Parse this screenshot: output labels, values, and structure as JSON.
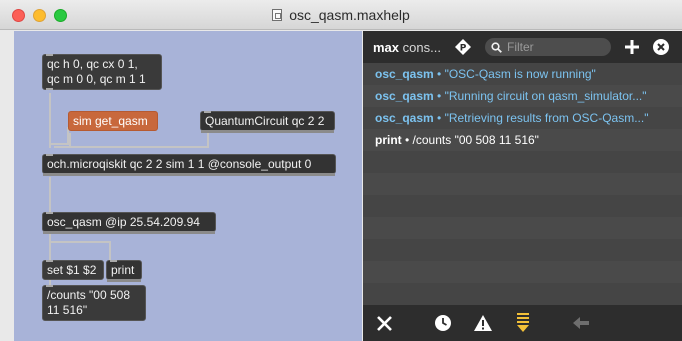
{
  "window": {
    "title": "osc_qasm.maxhelp"
  },
  "patcher": {
    "objects": {
      "qc_msg": "qc h 0, qc cx 0 1,\nqc m 0 0, qc m 1 1",
      "sim_msg": "sim get_qasm",
      "qc_obj": "QuantumCircuit qc 2 2",
      "och_obj": "och.microqiskit qc 2 2 sim 1 1 @console_output 0",
      "osc_obj": "osc_qasm @ip 25.54.209.94",
      "set_msg": "set $1 $2",
      "print_obj": "print",
      "result_msg": "/counts \"00 508\n11 516\""
    }
  },
  "console": {
    "title_bold": "max",
    "title_rest": " cons...",
    "filter_placeholder": "Filter",
    "rows": [
      {
        "source": "osc_qasm",
        "sep": " • ",
        "message": "\"OSC-Qasm is now running\""
      },
      {
        "source": "osc_qasm",
        "sep": " • ",
        "message": "\"Running circuit on qasm_simulator...\""
      },
      {
        "source": "osc_qasm",
        "sep": " • ",
        "message": "\"Retrieving results from OSC-Qasm...\""
      },
      {
        "source": "print",
        "sep": " • ",
        "message": "/counts \"00 508 11 516\""
      }
    ],
    "icons": [
      "pin-icon",
      "search-icon",
      "add-icon",
      "close-circle-icon",
      "clear-icon",
      "clock-icon",
      "warning-icon",
      "scroll-down-icon",
      "back-arrow-icon"
    ]
  }
}
